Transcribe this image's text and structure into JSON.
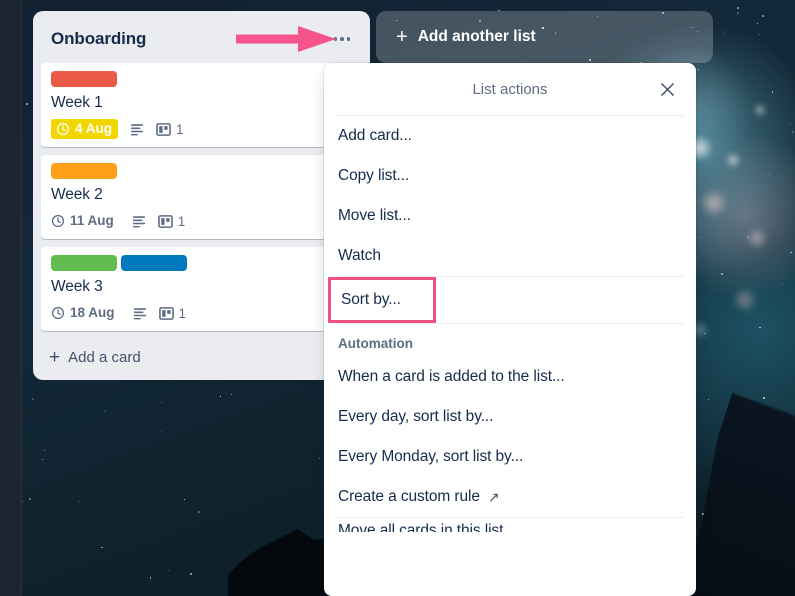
{
  "board": {
    "list": {
      "title": "Onboarding",
      "menu_button_icon": "ellipsis-icon",
      "add_card_label": "Add a card",
      "cards": [
        {
          "title": "Week 1",
          "labels": [
            "#eb5a46"
          ],
          "due_date": "4 Aug",
          "due_state": "due-soon",
          "due_color": "#f2d600",
          "due_text_color": "#ffffff",
          "has_description": true,
          "attachment_icon": "board-icon",
          "attachment_count": "1"
        },
        {
          "title": "Week 2",
          "labels": [
            "#ff9f1a"
          ],
          "due_date": "11 Aug",
          "due_state": "normal",
          "due_color": "transparent",
          "due_text_color": "#5e6c84",
          "has_description": true,
          "attachment_icon": "board-icon",
          "attachment_count": "1"
        },
        {
          "title": "Week 3",
          "labels": [
            "#61bd4f",
            "#0079bf"
          ],
          "due_date": "18 Aug",
          "due_state": "normal",
          "due_color": "transparent",
          "due_text_color": "#5e6c84",
          "has_description": true,
          "attachment_icon": "board-icon",
          "attachment_count": "1"
        }
      ]
    },
    "add_another_list_label": "Add another list"
  },
  "popup": {
    "title": "List actions",
    "close_icon": "close-icon",
    "items_primary": [
      "Add card...",
      "Copy list...",
      "Move list...",
      "Watch"
    ],
    "sort_by_label": "Sort by...",
    "automation_heading": "Automation",
    "automation_items": [
      "When a card is added to the list...",
      "Every day, sort list by...",
      "Every Monday, sort list by...",
      "Create a custom rule"
    ],
    "custom_rule_external_icon": "↗",
    "clipped_item": "Move all cards in this list..."
  },
  "annotations": {
    "arrow_color": "#f5548c",
    "highlight_color": "#f0507e",
    "arrow_target": "list-menu-button",
    "highlight_target": "sort-by-menu-item"
  }
}
